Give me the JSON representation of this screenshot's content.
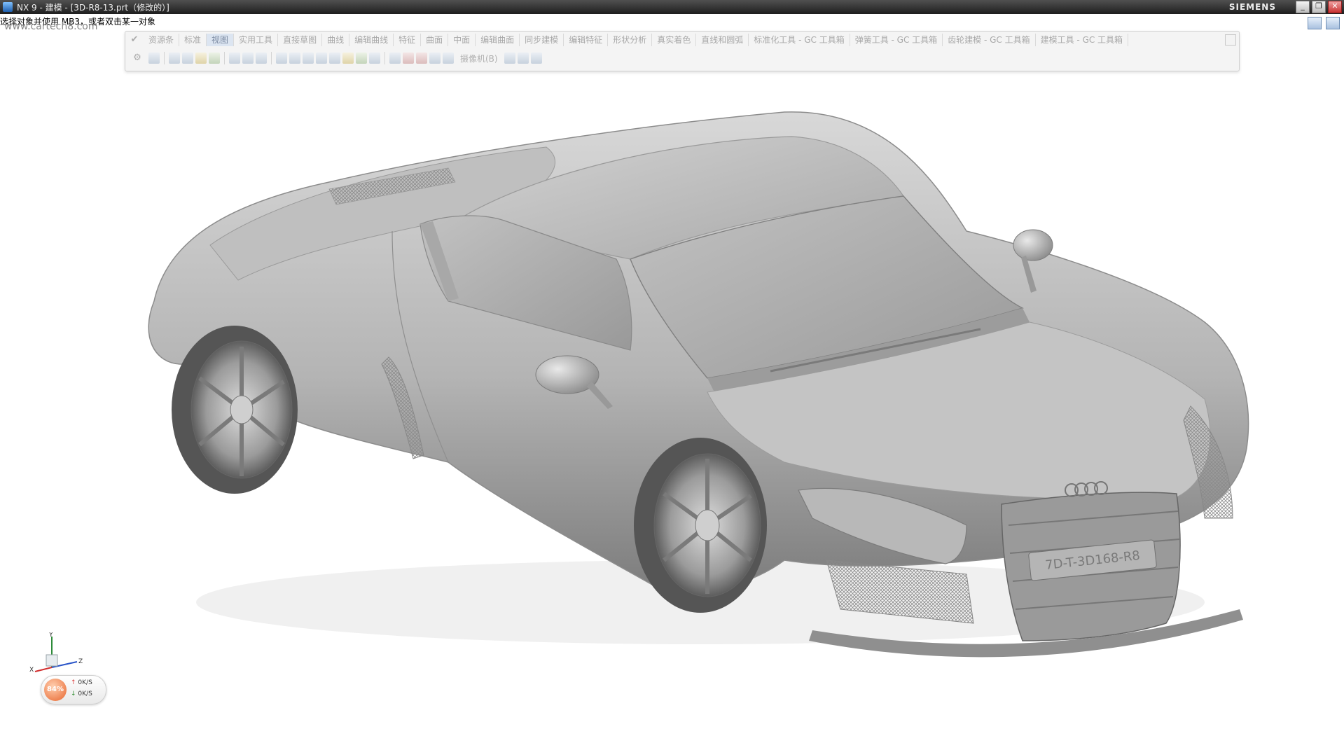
{
  "window": {
    "title": "NX 9 - 建模 - [3D-R8-13.prt（修改的）]",
    "brand": "SIEMENS",
    "buttons": {
      "minimize": "_",
      "restore": "❐",
      "close": "✕"
    }
  },
  "status": {
    "prompt": "选择对象并使用 MB3，或者双击某一对象",
    "watermark": "www.cartech8.com"
  },
  "ribbon": {
    "tabs": [
      "资源条",
      "标准",
      "视图",
      "实用工具",
      "直接草图",
      "曲线",
      "编辑曲线",
      "特征",
      "曲面",
      "中面",
      "编辑曲面",
      "同步建模",
      "编辑特征",
      "形状分析",
      "真实着色",
      "直线和圆弧",
      "标准化工具 - GC 工具箱",
      "弹簧工具 - GC 工具箱",
      "齿轮建模 - GC 工具箱",
      "建模工具 - GC 工具箱"
    ],
    "active_tab_index": 2,
    "camera_label": "摄像机(B)"
  },
  "triad": {
    "x": "X",
    "y": "Y",
    "z": "Z"
  },
  "network": {
    "percent": "84%",
    "up_arrow": "↑",
    "down_arrow": "↓",
    "up_rate": "0K/S",
    "down_rate": "0K/S"
  },
  "model": {
    "license_plate": "7D-T-3D168-R8",
    "brand_rings": "four-rings-logo"
  },
  "colors": {
    "body_light": "#c9c9c9",
    "body_mid": "#a9a9a9",
    "body_dark": "#6f6f6f",
    "titlebar": "#2a2a2a",
    "network_accent": "#e8652d"
  }
}
